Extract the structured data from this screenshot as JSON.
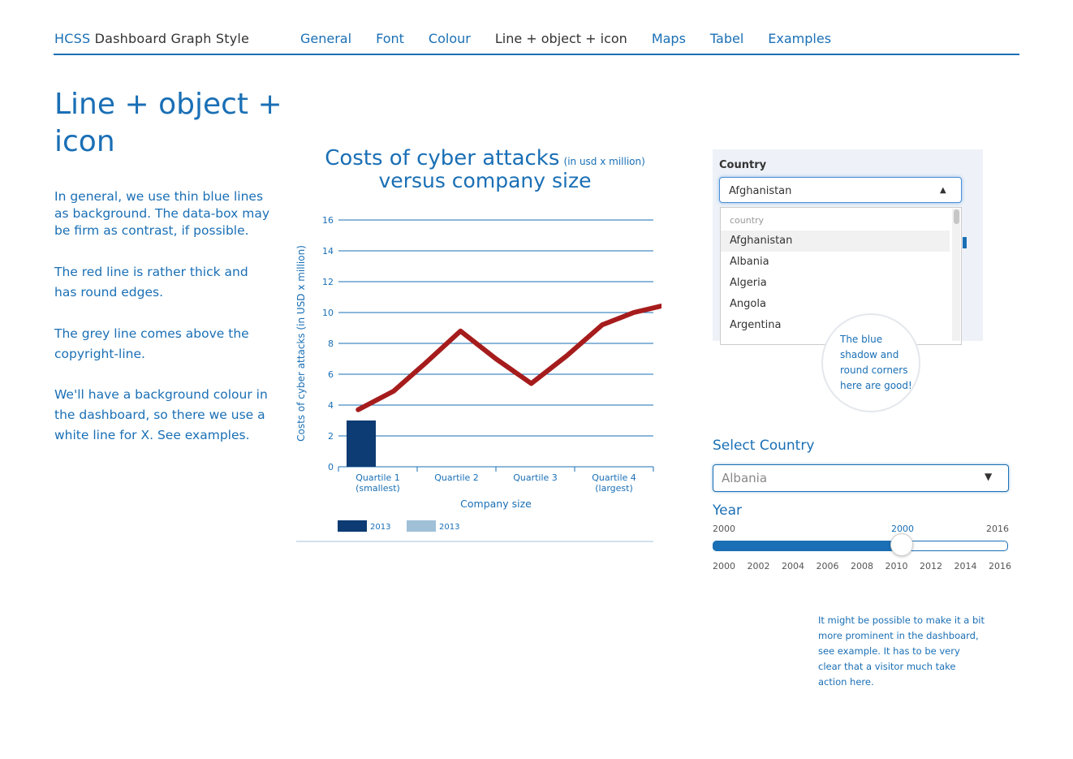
{
  "header": {
    "brand_prefix": "HCSS",
    "brand_suffix": " Dashboard Graph Style",
    "nav": [
      "General",
      "Font",
      "Colour",
      "Line + object + icon",
      "Maps",
      "Tabel",
      "Examples"
    ],
    "active_nav": "Line + object + icon"
  },
  "left": {
    "title": "Line + object + icon",
    "paragraphs": [
      "In general, we use thin blue lines as background. The data-box may be firm as contrast, if possible.",
      "The red line is rather thick and has round edges.",
      "The grey line comes above the copyright-line.",
      "We'll have a background colour in the dashboard, so there we use a white line for X. See examples."
    ]
  },
  "chart_title": {
    "line1": "Costs of cyber attacks",
    "unit_note": "(in usd x million)",
    "line2": "versus company size"
  },
  "chart_data": {
    "type": "bar+line",
    "title": "Costs of cyber attacks (in usd x million) versus company size",
    "xlabel": "Company size",
    "ylabel": "Costs of cyber attacks (in USD x million)",
    "ylim": [
      0,
      16
    ],
    "yticks": [
      0,
      2,
      4,
      6,
      8,
      10,
      12,
      14,
      16
    ],
    "categories": [
      "Quartile 1\n(smallest)",
      "Quartile 2",
      "Quartile 3",
      "Quartile 4\n(largest)"
    ],
    "category_lines": [
      [
        "Quartile 1",
        "(smallest)"
      ],
      [
        "Quartile 2"
      ],
      [
        "Quartile 3"
      ],
      [
        "Quartile 4",
        "(largest)"
      ]
    ],
    "bar_series": {
      "name": "2013",
      "values": [
        3.0,
        null,
        null,
        null
      ],
      "color": "#0d3b73"
    },
    "line_series": {
      "color": "#a61c1c",
      "points": [
        [
          0.75,
          3.7
        ],
        [
          1.2,
          4.9
        ],
        [
          1.6,
          6.7
        ],
        [
          2.05,
          8.8
        ],
        [
          2.5,
          7.0
        ],
        [
          2.95,
          5.4
        ],
        [
          3.4,
          7.2
        ],
        [
          3.85,
          9.2
        ],
        [
          4.25,
          10.0
        ],
        [
          4.75,
          10.6
        ]
      ]
    },
    "legend": [
      {
        "label": "2013",
        "color": "#0d3b73"
      },
      {
        "label": "2013",
        "color": "#a0c0d8"
      }
    ],
    "grid": true,
    "legend_position": "bottom-left"
  },
  "country_widget": {
    "label": "Country",
    "selected": "Afghanistan",
    "options_header": "country",
    "options": [
      "Afghanistan",
      "Albania",
      "Algeria",
      "Angola",
      "Argentina"
    ]
  },
  "callout": "The blue shadow and round corners here are good!",
  "select_country": {
    "label": "Select Country",
    "value": "Albania"
  },
  "year_slider": {
    "label": "Year",
    "min": "2000",
    "max": "2016",
    "value": "2000",
    "fill_fraction": 0.63,
    "ticks": [
      "2000",
      "2002",
      "2004",
      "2006",
      "2008",
      "2010",
      "2012",
      "2014",
      "2016"
    ]
  },
  "note": "It might be possible to make it a bit more prominent in the dashboard, see example. It has to be very clear that a visitor much take action here."
}
